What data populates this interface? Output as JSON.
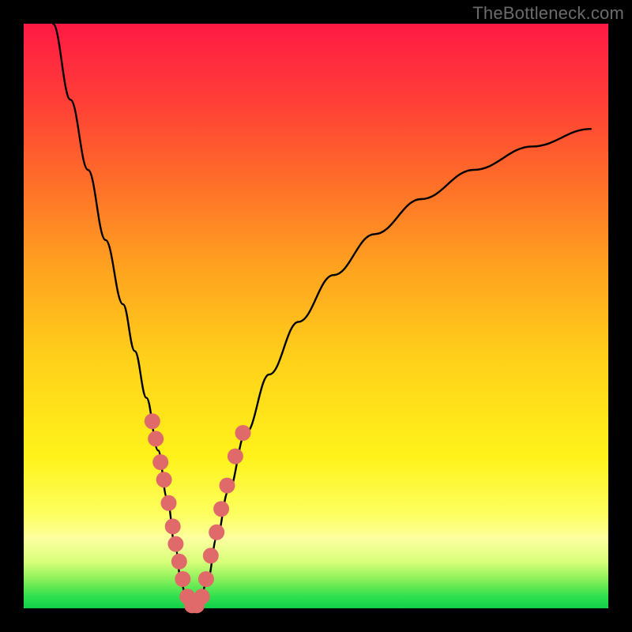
{
  "watermark": "TheBottleneck.com",
  "chart_data": {
    "type": "line",
    "title": "",
    "xlabel": "",
    "ylabel": "",
    "xlim": [
      0,
      100
    ],
    "ylim": [
      0,
      100
    ],
    "grid": false,
    "legend": false,
    "series": [
      {
        "name": "bottleneck-curve",
        "color": "#000000",
        "x": [
          5,
          8,
          11,
          14,
          17,
          19,
          21,
          23,
          24.5,
          26,
          27,
          28,
          29,
          30,
          31.5,
          33,
          35,
          38,
          42,
          47,
          53,
          60,
          68,
          77,
          87,
          97
        ],
        "y": [
          100,
          87,
          75,
          63,
          52,
          44,
          36,
          27,
          19,
          10,
          4,
          1,
          0,
          1,
          5,
          12,
          20,
          30,
          40,
          49,
          57,
          64,
          70,
          75,
          79,
          82
        ]
      }
    ],
    "markers": [
      {
        "name": "left-branch-dots",
        "color": "#e06a6a",
        "radius": 10,
        "points": [
          {
            "x": 22.0,
            "y": 32
          },
          {
            "x": 22.6,
            "y": 29
          },
          {
            "x": 23.4,
            "y": 25
          },
          {
            "x": 24.0,
            "y": 22
          },
          {
            "x": 24.8,
            "y": 18
          },
          {
            "x": 25.5,
            "y": 14
          },
          {
            "x": 26.0,
            "y": 11
          },
          {
            "x": 26.6,
            "y": 8
          },
          {
            "x": 27.2,
            "y": 5
          },
          {
            "x": 28.0,
            "y": 2
          },
          {
            "x": 28.8,
            "y": 0.5
          },
          {
            "x": 29.6,
            "y": 0.5
          }
        ]
      },
      {
        "name": "right-branch-dots",
        "color": "#e06a6a",
        "radius": 10,
        "points": [
          {
            "x": 30.5,
            "y": 2
          },
          {
            "x": 31.2,
            "y": 5
          },
          {
            "x": 32.0,
            "y": 9
          },
          {
            "x": 33.0,
            "y": 13
          },
          {
            "x": 33.8,
            "y": 17
          },
          {
            "x": 34.8,
            "y": 21
          },
          {
            "x": 36.2,
            "y": 26
          },
          {
            "x": 37.5,
            "y": 30
          }
        ]
      }
    ]
  }
}
